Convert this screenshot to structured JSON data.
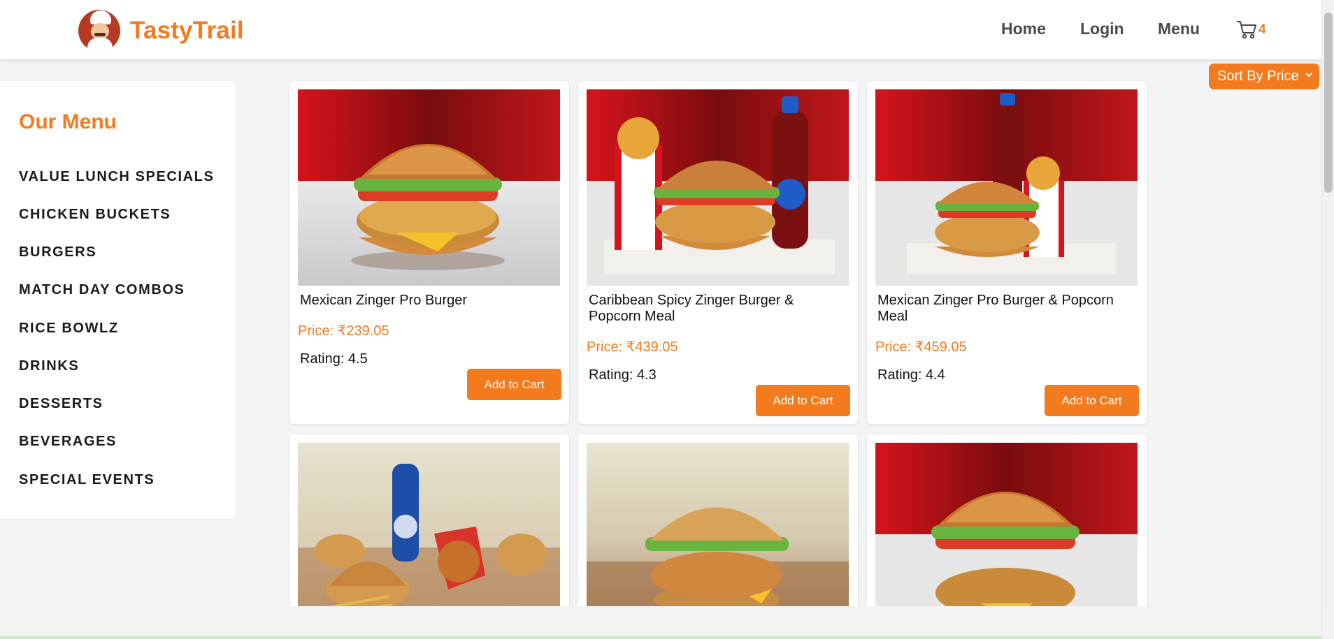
{
  "brand": {
    "name": "TastyTrail"
  },
  "nav": {
    "home": "Home",
    "login": "Login",
    "menu": "Menu",
    "cart_count": "4"
  },
  "sort": {
    "label": "Sort By Price"
  },
  "sidebar": {
    "title": "Our Menu",
    "items": [
      "VALUE LUNCH SPECIALS",
      "CHICKEN BUCKETS",
      "BURGERS",
      "MATCH DAY COMBOS",
      "RICE BOWLZ",
      "DRINKS",
      "DESSERTS",
      "BEVERAGES",
      "SPECIAL EVENTS"
    ]
  },
  "products": [
    {
      "name": "Mexican Zinger Pro Burger",
      "price": "Price: ₹239.05",
      "rating": "Rating: 4.5",
      "button": "Add to Cart"
    },
    {
      "name": "Caribbean Spicy Zinger Burger & Popcorn Meal",
      "price": "Price: ₹439.05",
      "rating": "Rating: 4.3",
      "button": "Add to Cart"
    },
    {
      "name": "Mexican Zinger Pro Burger & Popcorn Meal",
      "price": "Price: ₹459.05",
      "rating": "Rating: 4.4",
      "button": "Add to Cart"
    }
  ],
  "colors": {
    "accent": "#f47a1e",
    "card_bg": "#ffffff",
    "page_bg": "#f3f4f6",
    "banner_red": "#b30f13"
  },
  "icons": {
    "cart": "cart-icon",
    "sort_chevron": "chevron-down-icon",
    "logo": "chef-logo-icon"
  }
}
